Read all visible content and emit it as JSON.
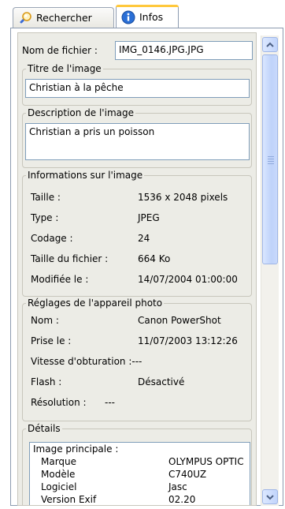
{
  "tabs": [
    {
      "label": "Rechercher",
      "icon": "search-magnifier-icon"
    },
    {
      "label": "Infos",
      "icon": "info-icon"
    }
  ],
  "file": {
    "label": "Nom de fichier :",
    "value": "IMG_0146.JPG.JPG"
  },
  "title": {
    "legend": "Titre de l'image",
    "value": "Christian à la pêche"
  },
  "description": {
    "legend": "Description de l'image",
    "value": "Christian a pris un poisson"
  },
  "image_info": {
    "legend": "Informations sur l'image",
    "rows": [
      {
        "key": "Taille :",
        "value": "1536 x 2048 pixels"
      },
      {
        "key": "Type :",
        "value": "JPEG"
      },
      {
        "key": "Codage :",
        "value": "24"
      },
      {
        "key": "Taille du fichier :",
        "value": "664 Ko"
      },
      {
        "key": "Modifiée le :",
        "value": "14/07/2004  01:00:00"
      }
    ]
  },
  "camera": {
    "legend": "Réglages de l'appareil photo",
    "rows": [
      {
        "key": "Nom :",
        "value": "Canon PowerShot"
      },
      {
        "key": "Prise le :",
        "value": "11/07/2003  13:12:26"
      },
      {
        "key": "Vitesse d'obturation :",
        "value": "---"
      },
      {
        "key": "Flash :",
        "value": "Désactivé"
      },
      {
        "key": "Résolution :",
        "value": "---"
      }
    ]
  },
  "details": {
    "legend": "Détails",
    "header": "Image principale :",
    "rows": [
      {
        "key": "Marque",
        "value": "OLYMPUS OPTIC"
      },
      {
        "key": "Modèle",
        "value": "C740UZ"
      },
      {
        "key": "Logiciel",
        "value": "Jasc"
      },
      {
        "key": "Version Exif",
        "value": "02.20"
      }
    ]
  },
  "colors": {
    "panel_bg": "#ecece6",
    "input_border": "#7f9db9",
    "tab_highlight": "#ffc83c",
    "scrollbar": "#c1d4fb"
  }
}
